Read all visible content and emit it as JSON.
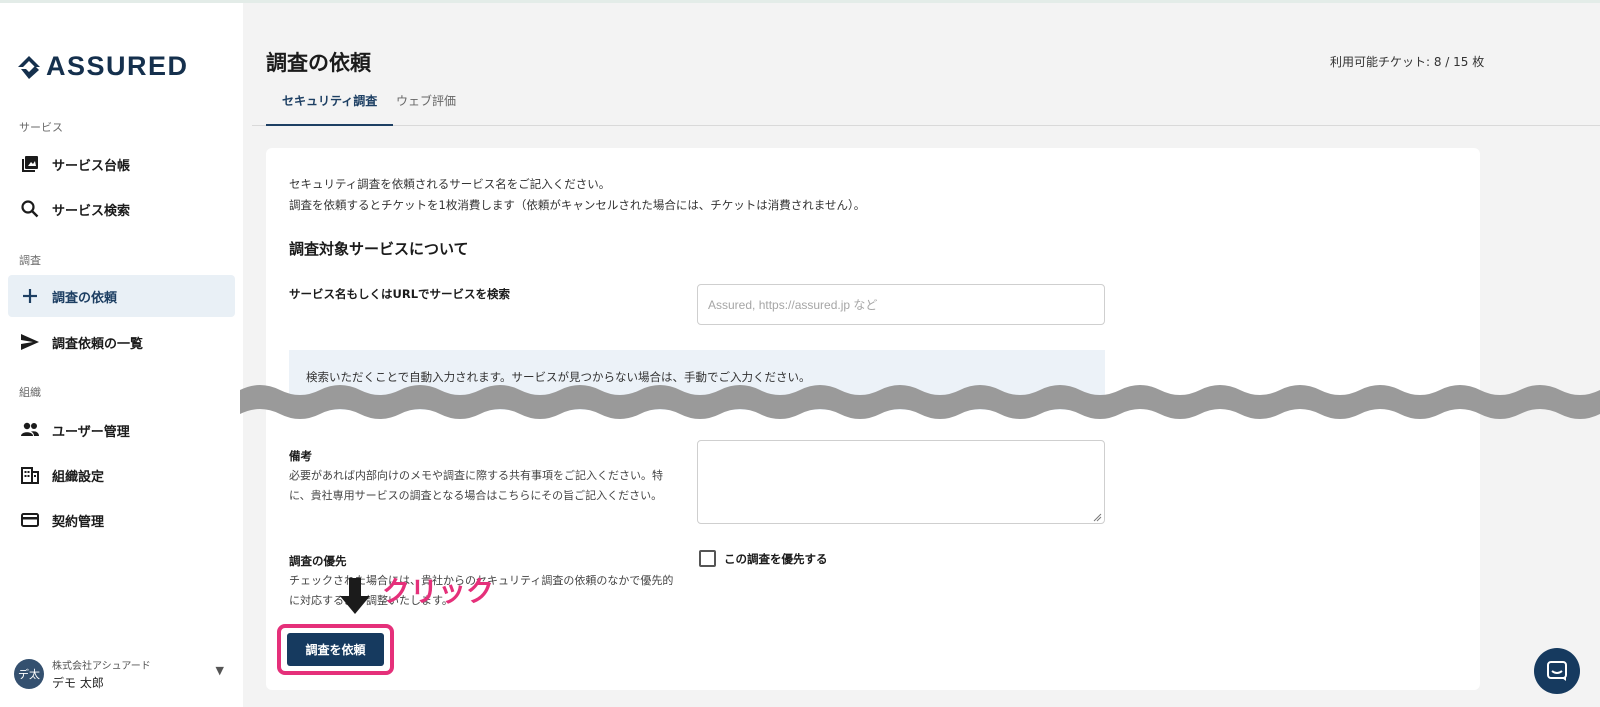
{
  "app": {
    "logo_text": "ASSURED"
  },
  "sidebar": {
    "sections": {
      "service": "サービス",
      "survey": "調査",
      "org": "組織"
    },
    "items": [
      {
        "label": "サービス台帳",
        "icon": "library-icon"
      },
      {
        "label": "サービス検索",
        "icon": "search-icon"
      },
      {
        "label": "調査の依頼",
        "icon": "plus-icon",
        "active": true
      },
      {
        "label": "調査依頼の一覧",
        "icon": "send-icon"
      },
      {
        "label": "ユーザー管理",
        "icon": "people-icon"
      },
      {
        "label": "組織設定",
        "icon": "building-icon"
      },
      {
        "label": "契約管理",
        "icon": "card-icon"
      }
    ],
    "user": {
      "avatar": "デ太",
      "org": "株式会社アシュアード",
      "name": "デモ 太郎"
    }
  },
  "header": {
    "title": "調査の依頼",
    "tickets": "利用可能チケット: 8 / 15 枚",
    "tabs": [
      {
        "label": "セキュリティ調査",
        "active": true
      },
      {
        "label": "ウェブ評価",
        "active": false
      }
    ]
  },
  "form": {
    "intro_line1": "セキュリティ調査を依頼されるサービス名をご記入ください。",
    "intro_line2": "調査を依頼するとチケットを1枚消費します（依頼がキャンセルされた場合には、チケットは消費されません）。",
    "section_heading": "調査対象サービスについて",
    "search_label": "サービス名もしくはURLでサービスを検索",
    "search_placeholder": "Assured, https://assured.jp など",
    "info_text": "検索いただくことで自動入力されます。サービスが見つからない場合は、手動でご入力ください。",
    "notes_label": "備考",
    "notes_help": "必要があれば内部向けのメモや調査に際する共有事項をご記入ください。特に、貴社専用サービスの調査となる場合はこちらにその旨ご記入ください。",
    "priority_label": "調査の優先",
    "priority_help": "チェックされた場合には、貴社からのセキュリティ調査の依頼のなかで優先的に対応するよう調整いたします。",
    "priority_checkbox": "この調査を優先する",
    "submit_label": "調査を依頼"
  },
  "annotation": {
    "click_text": "クリック",
    "accent_color": "#e5307a"
  },
  "colors": {
    "primary": "#163a5f",
    "sidebar_active_bg": "#e9f0f6",
    "info_bg": "#ecf2f8"
  }
}
